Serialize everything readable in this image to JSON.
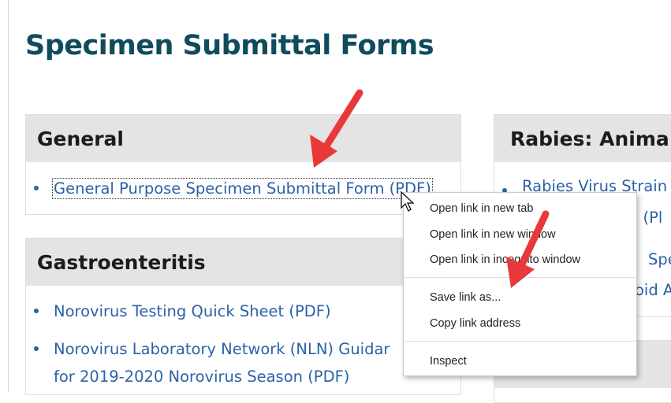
{
  "page": {
    "title": "Specimen Submittal Forms"
  },
  "sections": {
    "general": {
      "heading": "General",
      "links": [
        "General Purpose Specimen Submittal Form (PDF)"
      ]
    },
    "gastroenteritis": {
      "heading": "Gastroenteritis",
      "links": [
        "Norovirus Testing Quick Sheet (PDF)",
        "Norovirus Laboratory Network (NLN) Guidar",
        "for 2019-2020 Norovirus Season (PDF)"
      ]
    },
    "rabies": {
      "heading": "Rabies: Anima",
      "fragments": [
        "Rabies Virus Strain",
        "n (Pl",
        "Spec",
        "oid A"
      ]
    }
  },
  "context_menu": {
    "items": [
      "Open link in new tab",
      "Open link in new window",
      "Open link in incognito window",
      "Save link as...",
      "Copy link address",
      "Inspect"
    ]
  },
  "colors": {
    "title": "#0f4b5c",
    "link": "#2b62a8",
    "header_bg": "#e4e4e4",
    "annotation_arrow": "#e8393a"
  },
  "icons": [
    "mouse-cursor-icon",
    "annotation-arrow-icon"
  ]
}
